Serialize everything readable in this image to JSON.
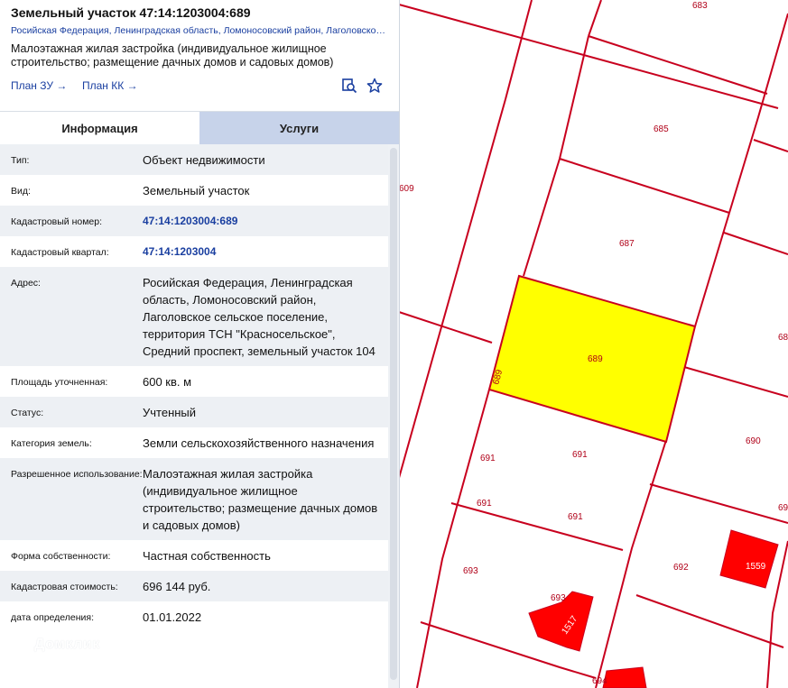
{
  "header": {
    "title": "Земельный участок 47:14:1203004:689",
    "address": "Росийская Федерация, Ленинградская область, Ломоносовский район, Лаголовское сельское поселение, территория ТСН \"Красносельское\", Средний…",
    "use": "Малоэтажная жилая застройка (индивидуальное жилищное строительство; размещение дачных домов и садовых домов)",
    "plan_zu": "План ЗУ →",
    "plan_kk": "План КК →",
    "icons": [
      "map-search-icon",
      "star-icon"
    ]
  },
  "tabs": [
    {
      "label": "Информация",
      "active": true
    },
    {
      "label": "Услуги",
      "active": false
    }
  ],
  "info": [
    {
      "label": "Тип:",
      "value": "Объект недвижимости"
    },
    {
      "label": "Вид:",
      "value": "Земельный участок"
    },
    {
      "label": "Кадастровый номер:",
      "value": "47:14:1203004:689",
      "link": true
    },
    {
      "label": "Кадастровый квартал:",
      "value": "47:14:1203004",
      "link": true
    },
    {
      "label": "Адрес:",
      "value": "Росийская Федерация, Ленинградская область, Ломоносовский район, Лаголовское сельское поселение, территория ТСН \"Красносельское\", Средний проспект, земельный участок 104"
    },
    {
      "label": "Площадь уточненная:",
      "value": "600 кв. м"
    },
    {
      "label": "Статус:",
      "value": "Учтенный"
    },
    {
      "label": "Категория земель:",
      "value": "Земли сельскохозяйственного назначения"
    },
    {
      "label": "Разрешенное использование:",
      "value": "Малоэтажная жилая застройка (индивидуальное жилищное строительство; размещение дачных домов и садовых домов)"
    },
    {
      "label": "Форма собственности:",
      "value": "Частная собственность"
    },
    {
      "label": "Кадастровая стоимость:",
      "value": "696 144 руб."
    },
    {
      "label": "дата определения:",
      "value": "01.01.2022"
    }
  ],
  "watermark": "Домклик",
  "map": {
    "selected_plot": "689",
    "selected_color": "#ffff00",
    "boundary_color": "#c8001e",
    "labels": [
      "683",
      "685",
      "687",
      "609",
      "689",
      "689",
      "68",
      "690",
      "691",
      "691",
      "691",
      "691",
      "693",
      "692",
      "693",
      "1559",
      "1517",
      "694",
      "69"
    ]
  }
}
